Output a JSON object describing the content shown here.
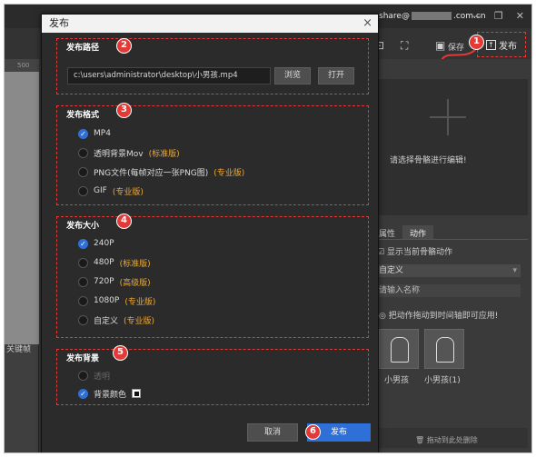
{
  "app": {
    "account_prefix": "share@",
    "account_suffix": ".com.cn",
    "save_label": "保存",
    "publish_label": "发布",
    "ruler_value": "500",
    "left_label": "关键帧",
    "canvas_hint": "请选择骨骼进行编辑!",
    "tabs": [
      {
        "label": "属性"
      },
      {
        "label": "动作"
      }
    ],
    "show_bone_action": "显示当前骨骼动作",
    "dropdown_value": "自定义",
    "name_placeholder": "请输入名称",
    "drag_tip": "把动作拖动到时间轴即可应用!",
    "thumbs": [
      {
        "label": "小男孩"
      },
      {
        "label": "小男孩(1)"
      }
    ],
    "bottom_text": "拖动到此处删除"
  },
  "dialog": {
    "title": "发布",
    "close_glyph": "×",
    "sections": {
      "path": {
        "title": "发布路径",
        "badge": "2",
        "path_value": "c:\\users\\administrator\\desktop\\小男孩.mp4",
        "browse_label": "浏览",
        "open_label": "打开"
      },
      "format": {
        "title": "发布格式",
        "badge": "3",
        "options": [
          {
            "label": "MP4",
            "tag": "",
            "checked": true
          },
          {
            "label": "透明背景Mov",
            "tag": "(标准版)",
            "checked": false
          },
          {
            "label": "PNG文件(每帧对应一张PNG图)",
            "tag": "(专业版)",
            "checked": false
          },
          {
            "label": "GIF",
            "tag": "(专业版)",
            "checked": false
          }
        ]
      },
      "size": {
        "title": "发布大小",
        "badge": "4",
        "options": [
          {
            "label": "240P",
            "tag": "",
            "checked": true
          },
          {
            "label": "480P",
            "tag": "(标准版)",
            "checked": false
          },
          {
            "label": "720P",
            "tag": "(高级版)",
            "checked": false
          },
          {
            "label": "1080P",
            "tag": "(专业版)",
            "checked": false
          },
          {
            "label": "自定义",
            "tag": "(专业版)",
            "checked": false
          }
        ]
      },
      "background": {
        "title": "发布背景",
        "badge": "5",
        "transparent_label": "透明",
        "color_label": "背景颜色"
      }
    },
    "cancel_label": "取消",
    "publish_label": "发布",
    "publish_badge": "6",
    "top_badge": "1"
  },
  "colors": {
    "accent_blue": "#2f6fd8",
    "annotation_red": "#e53935",
    "tag_orange": "#f0a830"
  }
}
